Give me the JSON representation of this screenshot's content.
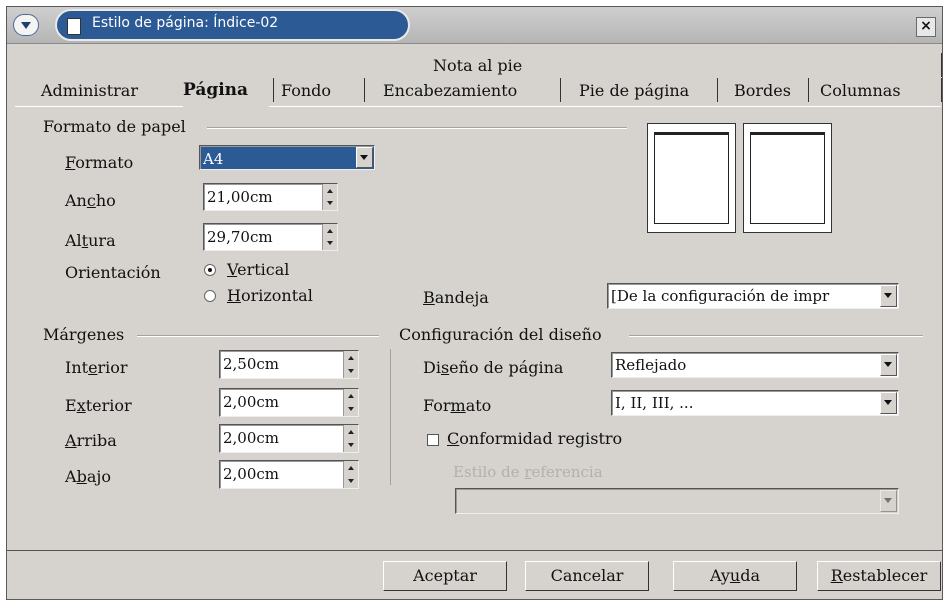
{
  "window": {
    "title": "Estilo de página: Índice-02",
    "close_symbol": "×"
  },
  "tabs": {
    "top_row": [
      "Nota al pie"
    ],
    "bottom_row": [
      "Administrar",
      "Página",
      "Fondo",
      "Encabezamiento",
      "Pie de página",
      "Bordes",
      "Columnas"
    ],
    "active": "Página"
  },
  "paper_format": {
    "section_label": "Formato de papel",
    "format_label": {
      "mnemonic": "F",
      "rest": "ormato"
    },
    "format_value": "A4",
    "width_label": {
      "pre": "An",
      "mnemonic": "c",
      "post": "ho"
    },
    "width_value": "21,00cm",
    "height_label": {
      "pre": "Al",
      "mnemonic": "t",
      "post": "ura"
    },
    "height_value": "29,70cm",
    "orientation_label": "Orientación",
    "orientation_vertical": {
      "mnemonic": "V",
      "rest": "ertical"
    },
    "orientation_horizontal": {
      "mnemonic": "H",
      "rest": "orizontal"
    },
    "orientation_selected": "Vertical",
    "tray_label": {
      "mnemonic": "B",
      "rest": "andeja"
    },
    "tray_value": "[De la configuración de impr"
  },
  "margins": {
    "section_label": "Márgenes",
    "inner_label": {
      "pre": "Int",
      "mnemonic": "e",
      "post": "rior"
    },
    "inner_value": "2,50cm",
    "outer_label": {
      "pre": "E",
      "mnemonic": "x",
      "post": "terior"
    },
    "outer_value": "2,00cm",
    "top_label": {
      "pre": "",
      "mnemonic": "A",
      "post": "rriba"
    },
    "top_value": "2,00cm",
    "bottom_label": {
      "pre": "A",
      "mnemonic": "b",
      "post": "ajo"
    },
    "bottom_value": "2,00cm"
  },
  "layout_settings": {
    "section_label": "Configuración del diseño",
    "page_layout_label": {
      "pre": "Di",
      "mnemonic": "s",
      "post": "eño de página"
    },
    "page_layout_value": "Reflejado",
    "format_label": {
      "pre": "For",
      "mnemonic": "m",
      "post": "ato"
    },
    "format_value": "I, II, III, ...",
    "register_true_label": {
      "mnemonic": "C",
      "rest": "onformidad registro"
    },
    "register_true_checked": false,
    "reference_style_label": {
      "pre": "Estilo de ",
      "mnemonic": "r",
      "post": "eferencia"
    },
    "reference_style_value": ""
  },
  "buttons": {
    "ok": "Aceptar",
    "cancel": "Cancelar",
    "help": {
      "pre": "Ay",
      "mnemonic": "u",
      "post": "da"
    },
    "reset": {
      "mnemonic": "R",
      "rest": "establecer"
    }
  },
  "colors": {
    "dialog_bg": "#d6d3ce",
    "title_bar_pill": "#2b5a95",
    "disabled_text": "#b3b0ab"
  }
}
